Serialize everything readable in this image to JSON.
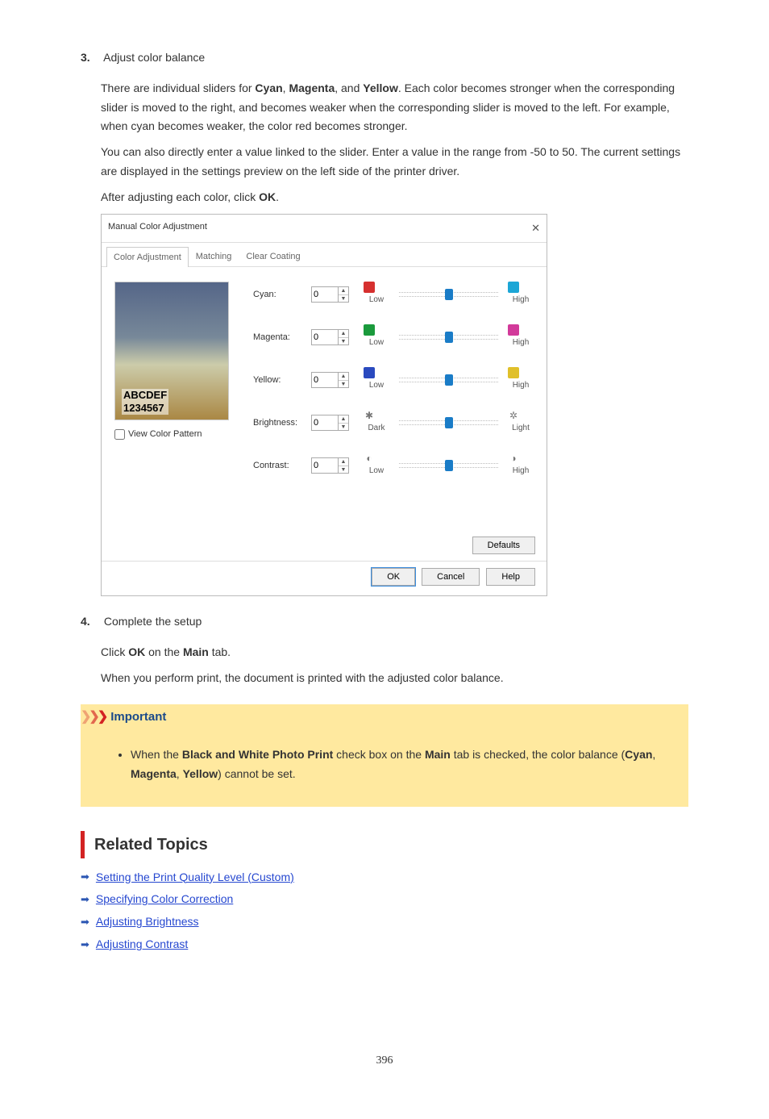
{
  "step3": {
    "num": "3.",
    "title": "Adjust color balance",
    "p1_a": "There are individual sliders for ",
    "p1_b": ", ",
    "p1_c": ", and ",
    "p1_d": ". Each color becomes stronger when the corresponding slider is moved to the right, and becomes weaker when the corresponding slider is moved to the left. For example, when cyan becomes weaker, the color red becomes stronger.",
    "b_cyan": "Cyan",
    "b_magenta": "Magenta",
    "b_yellow": "Yellow",
    "p2": "You can also directly enter a value linked to the slider. Enter a value in the range from -50 to 50. The current settings are displayed in the settings preview on the left side of the printer driver.",
    "p3_a": "After adjusting each color, click ",
    "p3_b": ".",
    "b_ok": "OK"
  },
  "dialog": {
    "title": "Manual Color Adjustment",
    "tabs": [
      "Color Adjustment",
      "Matching",
      "Clear Coating"
    ],
    "preview_t1": "ABCDEF",
    "preview_t2": "1234567",
    "view_pattern": "View Color Pattern",
    "rows": {
      "cyan": {
        "label": "Cyan:",
        "value": "0",
        "low": "Low",
        "high": "High",
        "low_color": "#d6302f",
        "high_color": "#1ca6d6"
      },
      "magenta": {
        "label": "Magenta:",
        "value": "0",
        "low": "Low",
        "high": "High",
        "low_color": "#1a9a3c",
        "high_color": "#d23a9a"
      },
      "yellow": {
        "label": "Yellow:",
        "value": "0",
        "low": "Low",
        "high": "High",
        "low_color": "#2a4abf",
        "high_color": "#e0c02a"
      },
      "brightness": {
        "label": "Brightness:",
        "value": "0",
        "low": "Dark",
        "high": "Light",
        "low_icon": "✱",
        "high_icon": "✲"
      },
      "contrast": {
        "label": "Contrast:",
        "value": "0",
        "low": "Low",
        "high": "High",
        "low_icon": "◐",
        "high_icon": "◑"
      }
    },
    "defaults": "Defaults",
    "ok": "OK",
    "cancel": "Cancel",
    "help": "Help"
  },
  "step4": {
    "num": "4.",
    "title": "Complete the setup",
    "p_a": "Click ",
    "p_b": " on the ",
    "p_c": " tab.",
    "b_ok": "OK",
    "b_main": "Main",
    "p2": "When you perform print, the document is printed with the adjusted color balance."
  },
  "important": {
    "title": "Important",
    "li_a": "When the ",
    "li_b": " check box on the ",
    "li_c": " tab is checked, the color balance (",
    "li_d": ", ",
    "li_e": ", ",
    "li_f": ") cannot be set.",
    "b1": "Black and White Photo Print",
    "b2": "Main",
    "b3": "Cyan",
    "b4": "Magenta",
    "b5": "Yellow"
  },
  "related": {
    "title": "Related Topics",
    "links": [
      "Setting the Print Quality Level (Custom)",
      "Specifying Color Correction",
      "Adjusting Brightness",
      "Adjusting Contrast"
    ]
  },
  "page": "396"
}
